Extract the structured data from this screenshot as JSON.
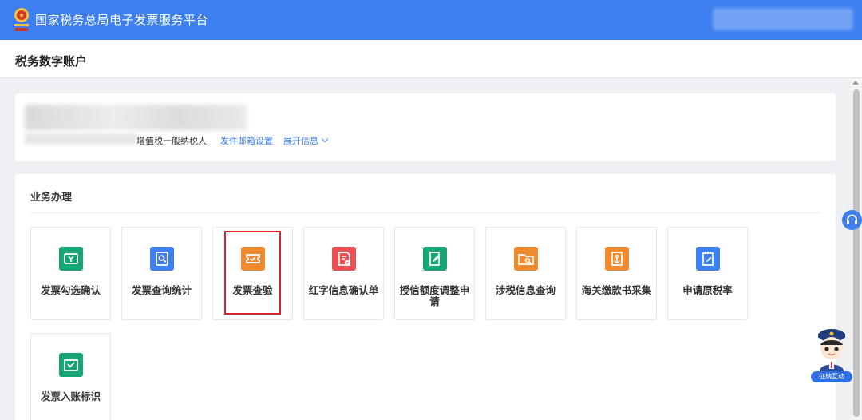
{
  "header": {
    "app_title": "国家税务总局电子发票服务平台",
    "brand_color": "#3d7ff0"
  },
  "subheader": {
    "page_title": "税务数字账户"
  },
  "account": {
    "tax_type": "增值税一般纳税人",
    "email_link": "发件邮箱设置",
    "expand_link": "展开信息"
  },
  "business": {
    "section_title": "业务办理",
    "tiles": [
      {
        "label": "发票勾选确认",
        "icon": "invoice-check-icon",
        "color": "#17a673"
      },
      {
        "label": "发票查询统计",
        "icon": "invoice-search-icon",
        "color": "#3d7ff0"
      },
      {
        "label": "发票查验",
        "icon": "ticket-verify-icon",
        "color": "#f08a2e"
      },
      {
        "label": "红字信息确认单",
        "icon": "red-document-icon",
        "color": "#ea4f52"
      },
      {
        "label": "授信额度调整申请",
        "icon": "edit-document-icon",
        "color": "#17a673"
      },
      {
        "label": "涉税信息查询",
        "icon": "folder-search-icon",
        "color": "#f08a2e"
      },
      {
        "label": "海关缴款书采集",
        "icon": "anchor-document-icon",
        "color": "#f08a2e"
      },
      {
        "label": "申请原税率",
        "icon": "clipboard-edit-icon",
        "color": "#3d7ff0"
      },
      {
        "label": "发票入账标识",
        "icon": "inbox-check-icon",
        "color": "#17a673"
      }
    ]
  },
  "float": {
    "helper_label": "征纳互动"
  }
}
